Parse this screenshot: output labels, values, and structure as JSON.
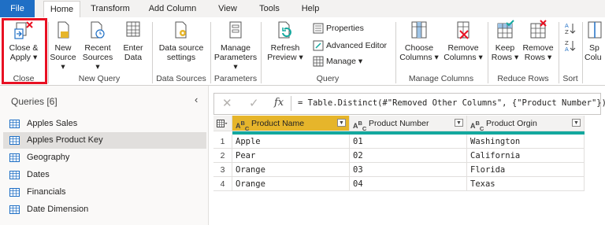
{
  "tabs": [
    "File",
    "Home",
    "Transform",
    "Add Column",
    "View",
    "Tools",
    "Help"
  ],
  "ribbon": {
    "close_apply": {
      "line1": "Close &",
      "line2": "Apply ▾",
      "group": "Close"
    },
    "new_query": {
      "new_source": {
        "line1": "New",
        "line2": "Source ▾"
      },
      "recent_sources": {
        "line1": "Recent",
        "line2": "Sources ▾"
      },
      "enter_data": {
        "line1": "Enter",
        "line2": "Data"
      },
      "group": "New Query"
    },
    "data_sources": {
      "line1": "Data source",
      "line2": "settings",
      "group": "Data Sources"
    },
    "parameters": {
      "line1": "Manage",
      "line2": "Parameters ▾",
      "group": "Parameters"
    },
    "query": {
      "refresh": {
        "line1": "Refresh",
        "line2": "Preview ▾"
      },
      "properties": "Properties",
      "advanced_editor": "Advanced Editor",
      "manage": "Manage ▾",
      "group": "Query"
    },
    "manage_columns": {
      "choose": {
        "line1": "Choose",
        "line2": "Columns ▾"
      },
      "remove": {
        "line1": "Remove",
        "line2": "Columns ▾"
      },
      "group": "Manage Columns"
    },
    "reduce_rows": {
      "keep": {
        "line1": "Keep",
        "line2": "Rows ▾"
      },
      "remove": {
        "line1": "Remove",
        "line2": "Rows ▾"
      },
      "group": "Reduce Rows"
    },
    "sort": {
      "group": "Sort"
    },
    "split": {
      "line1": "Sp",
      "line2": "Colu"
    }
  },
  "queries": {
    "header": "Queries [6]",
    "items": [
      "Apples Sales",
      "Apples Product Key",
      "Geography",
      "Dates",
      "Financials",
      "Date Dimension"
    ],
    "selected_index": 1
  },
  "formula": {
    "fx": "fx",
    "text": "= Table.Distinct(#\"Removed Other Columns\", {\"Product Number\"})"
  },
  "table": {
    "type_label": "A B C",
    "columns": [
      "Product Name",
      "Product Number",
      "Product Orgin"
    ],
    "rows": [
      [
        "1",
        "Apple",
        "01",
        "Washington"
      ],
      [
        "2",
        "Pear",
        "02",
        "California"
      ],
      [
        "3",
        "Orange",
        "03",
        "Florida"
      ],
      [
        "4",
        "Orange",
        "04",
        "Texas"
      ]
    ]
  },
  "colors": {
    "file_tab": "#1f6fc5",
    "highlight": "#e81123",
    "selected_column": "#e6b52b",
    "quality_bar": "#13a89e"
  }
}
